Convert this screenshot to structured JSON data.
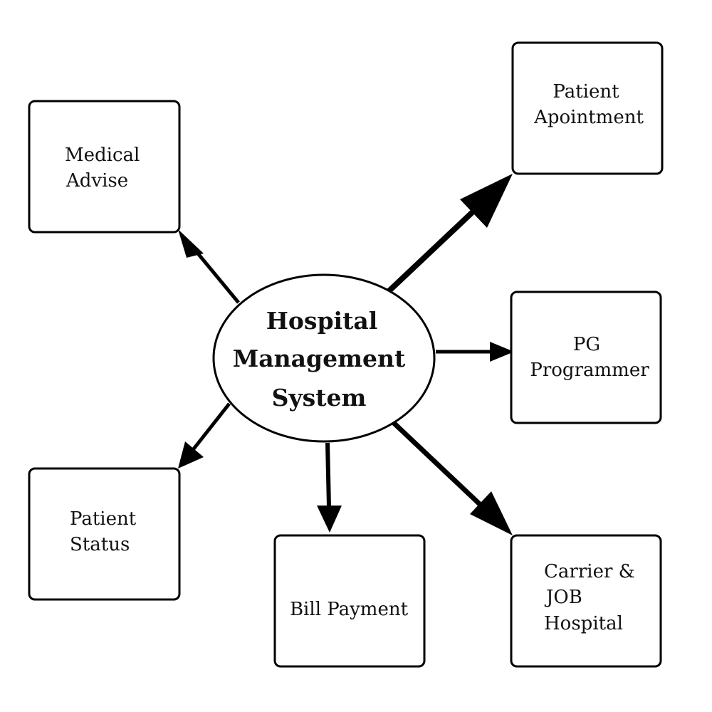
{
  "diagram": {
    "center": {
      "lines": [
        "Hospital",
        "Management",
        "System"
      ]
    },
    "nodes": {
      "medical_advise": {
        "lines": [
          "Medical",
          "Advise"
        ]
      },
      "patient_apointment": {
        "lines": [
          "Patient",
          "Apointment"
        ]
      },
      "pg_programmer": {
        "lines": [
          "PG",
          "Programmer"
        ]
      },
      "patient_status": {
        "lines": [
          "Patient",
          "Status"
        ]
      },
      "bill_payment": {
        "lines": [
          "Bill Payment"
        ]
      },
      "carrier_job_hospital": {
        "lines": [
          "Carrier &",
          "JOB",
          "Hospital"
        ]
      }
    },
    "edges": [
      {
        "from": "center",
        "to": "medical_advise"
      },
      {
        "from": "center",
        "to": "patient_apointment"
      },
      {
        "from": "center",
        "to": "pg_programmer"
      },
      {
        "from": "center",
        "to": "patient_status"
      },
      {
        "from": "center",
        "to": "bill_payment"
      },
      {
        "from": "center",
        "to": "carrier_job_hospital"
      }
    ],
    "colors": {
      "stroke": "#000000",
      "fill": "#ffffff",
      "text": "#111111"
    }
  }
}
